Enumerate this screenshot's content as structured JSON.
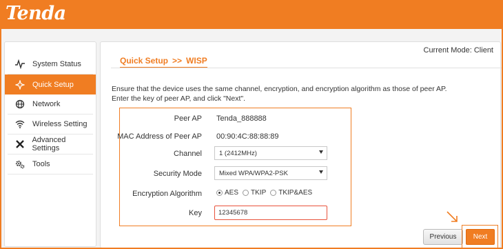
{
  "brand": {
    "logo_text": "Tenda",
    "accent_color": "#f07d22"
  },
  "current_mode": "Current Mode: Client",
  "breadcrumb": {
    "parent": "Quick Setup",
    "separator": ">>",
    "current": "WISP"
  },
  "sidebar": {
    "items": [
      {
        "label": "System Status",
        "icon": "pulse-icon",
        "active": false
      },
      {
        "label": "Quick Setup",
        "icon": "wand-icon",
        "active": true
      },
      {
        "label": "Network",
        "icon": "globe-icon",
        "active": false
      },
      {
        "label": "Wireless Setting",
        "icon": "wifi-icon",
        "active": false
      },
      {
        "label": "Advanced Settings",
        "icon": "tools-cross-icon",
        "active": false
      },
      {
        "label": "Tools",
        "icon": "gears-icon",
        "active": false
      }
    ]
  },
  "description": {
    "line1": "Ensure that the device uses the same channel, encryption, and encryption algorithm as those of peer AP.",
    "line2": "Enter the key of peer AP, and click \"Next\"."
  },
  "form": {
    "peer_ap": {
      "label": "Peer AP",
      "value": "Tenda_888888"
    },
    "mac": {
      "label": "MAC Address of Peer AP",
      "value": "00:90:4C:88:88:89"
    },
    "channel": {
      "label": "Channel",
      "value": "1 (2412MHz)"
    },
    "security": {
      "label": "Security Mode",
      "value": "Mixed WPA/WPA2-PSK"
    },
    "encryption": {
      "label": "Encryption Algorithm",
      "options": [
        "AES",
        "TKIP",
        "TKIP&AES"
      ],
      "selected": "AES"
    },
    "key": {
      "label": "Key",
      "value": "12345678"
    }
  },
  "buttons": {
    "previous": "Previous",
    "next": "Next"
  }
}
